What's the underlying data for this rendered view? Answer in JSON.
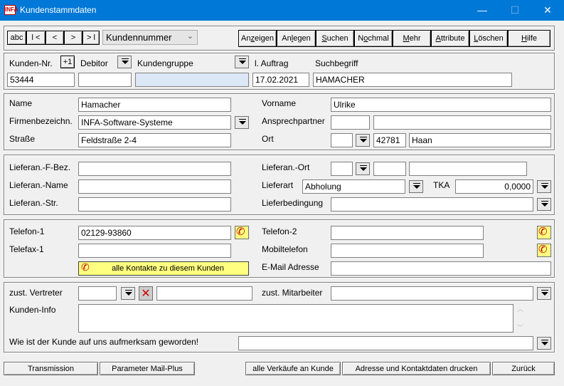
{
  "window": {
    "title": "Kundenstammdaten",
    "icon_text": "INFA",
    "minimize": "—",
    "maximize": "☐",
    "close": "✕"
  },
  "nav": {
    "abc": "abc",
    "first": "l <",
    "prev": "<",
    "next": ">",
    "last": "> l",
    "sort_select": "Kundennummer"
  },
  "toolbar": [
    {
      "pre": "An",
      "u": "z",
      "post": "eigen"
    },
    {
      "pre": "An",
      "u": "l",
      "post": "egen"
    },
    {
      "pre": "",
      "u": "S",
      "post": "uchen"
    },
    {
      "pre": "N",
      "u": "o",
      "post": "chmal"
    },
    {
      "pre": "",
      "u": "M",
      "post": "ehr"
    },
    {
      "pre": "",
      "u": "A",
      "post": "ttribute"
    },
    {
      "pre": "",
      "u": "L",
      "post": "öschen"
    },
    {
      "pre": "",
      "u": "H",
      "post": "ilfe"
    }
  ],
  "header": {
    "kunden_nr_label": "Kunden-Nr.",
    "plus_one": "+1",
    "kunden_nr": "53444",
    "debitor_label": "Debitor",
    "debitor": "",
    "kundengruppe_label": "Kundengruppe",
    "kundengruppe": "",
    "auftrag_label": "l. Auftrag",
    "auftrag": "17.02.2021",
    "suchbegriff_label": "Suchbegriff",
    "suchbegriff": "HAMACHER"
  },
  "address": {
    "name_label": "Name",
    "name": "Hamacher",
    "vorname_label": "Vorname",
    "vorname": "Ulrike",
    "firma_label": "Firmenbezeichn.",
    "firma": "INFA-Software-Systeme",
    "ansprech_label": "Ansprechpartner",
    "ansprech1": "",
    "ansprech2": "",
    "strasse_label": "Straße",
    "strasse": "Feldstraße 2-4",
    "ort_label": "Ort",
    "land": "",
    "plz": "42781",
    "ort": "Haan"
  },
  "delivery": {
    "fbez_label": "Lieferan.-F-Bez.",
    "fbez": "",
    "lort_label": "Lieferan.-Ort",
    "lland": "",
    "lplz": "",
    "lort": "",
    "lname_label": "Lieferan.-Name",
    "lname": "",
    "lieferart_label": "Lieferart",
    "lieferart": "Abholung",
    "tka_label": "TKA",
    "tka": "0,0000",
    "lstr_label": "Lieferan.-Str.",
    "lstr": "",
    "lbed_label": "Lieferbedingung",
    "lbed": ""
  },
  "contact": {
    "tel1_label": "Telefon-1",
    "tel1": "02129-93860",
    "tel2_label": "Telefon-2",
    "tel2": "",
    "fax_label": "Telefax-1",
    "fax": "",
    "mobil_label": "Mobiltelefon",
    "mobil": "",
    "kontakte_button": "alle Kontakte zu diesem Kunden",
    "email_label": "E-Mail Adresse",
    "email": ""
  },
  "misc": {
    "vertreter_label": "zust. Vertreter",
    "vertreter_code": "",
    "vertreter_name": "",
    "mitarbeiter_label": "zust. Mitarbeiter",
    "mitarbeiter": "",
    "info_label": "Kunden-Info",
    "info": "",
    "aufmerksam_label": "Wie ist der Kunde auf uns aufmerksam geworden!",
    "aufmerksam": ""
  },
  "bottom": {
    "transmission": "Transmission",
    "mailplus": "Parameter Mail-Plus",
    "verkaeufe": "alle Verkäufe an Kunde",
    "drucken": "Adresse und Kontaktdaten drucken",
    "zurueck": "Zurück"
  }
}
